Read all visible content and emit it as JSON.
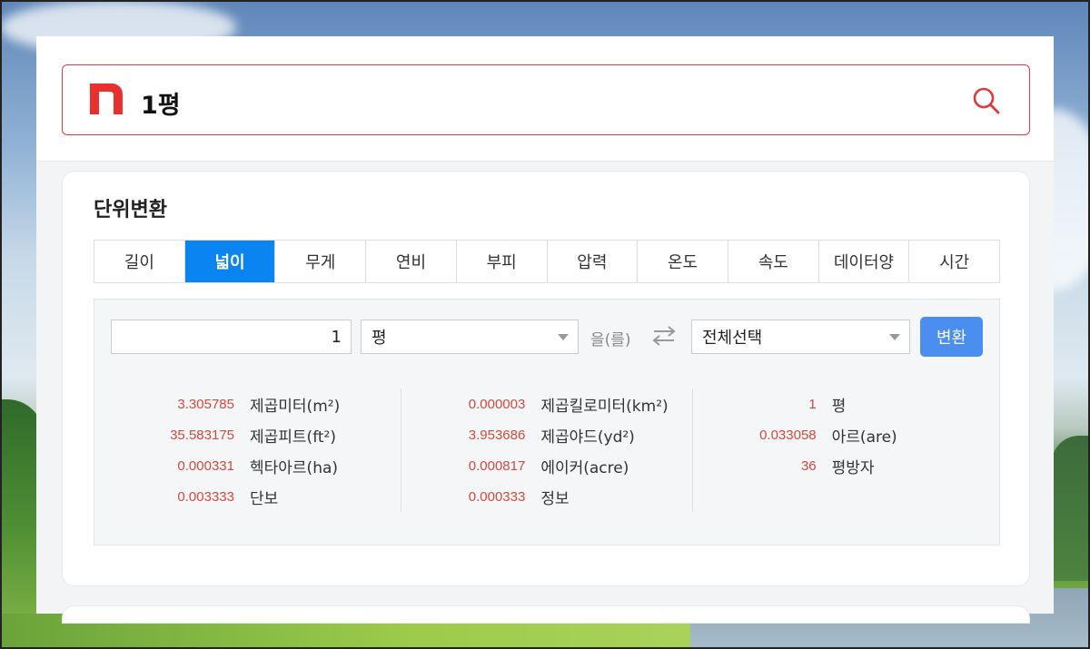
{
  "search": {
    "query": "1평",
    "logo_icon": "naver-n-logo",
    "search_icon": "search-icon",
    "brand_color": "#de3a3a"
  },
  "converter": {
    "title": "단위변환",
    "tabs": [
      {
        "label": "길이",
        "active": false
      },
      {
        "label": "넓이",
        "active": true
      },
      {
        "label": "무게",
        "active": false
      },
      {
        "label": "연비",
        "active": false
      },
      {
        "label": "부피",
        "active": false
      },
      {
        "label": "압력",
        "active": false
      },
      {
        "label": "온도",
        "active": false
      },
      {
        "label": "속도",
        "active": false
      },
      {
        "label": "데이터양",
        "active": false
      },
      {
        "label": "시간",
        "active": false
      }
    ],
    "input_value": "1",
    "from_unit": "평",
    "particle": "을(를)",
    "to_unit": "전체선택",
    "convert_label": "변환",
    "accent_color": "#0a84f0",
    "results": [
      [
        {
          "value": "3.305785",
          "unit": "제곱미터(m²)"
        },
        {
          "value": "35.583175",
          "unit": "제곱피트(ft²)"
        },
        {
          "value": "0.000331",
          "unit": "헥타아르(ha)"
        },
        {
          "value": "0.003333",
          "unit": "단보"
        }
      ],
      [
        {
          "value": "0.000003",
          "unit": "제곱킬로미터(km²)"
        },
        {
          "value": "3.953686",
          "unit": "제곱야드(yd²)"
        },
        {
          "value": "0.000817",
          "unit": "에이커(acre)"
        },
        {
          "value": "0.000333",
          "unit": "정보"
        }
      ],
      [
        {
          "value": "1",
          "unit": "평"
        },
        {
          "value": "0.033058",
          "unit": "아르(are)"
        },
        {
          "value": "36",
          "unit": "평방자"
        }
      ]
    ]
  }
}
